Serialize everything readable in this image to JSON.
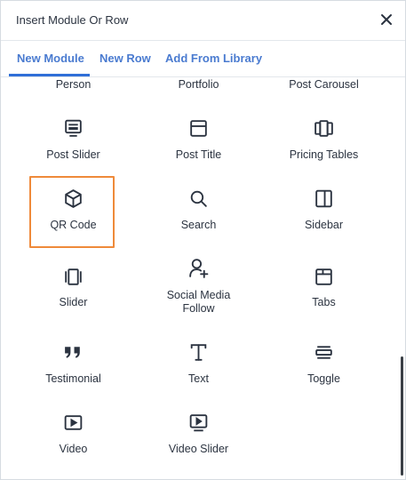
{
  "modal": {
    "title": "Insert Module Or Row",
    "close_icon": "close-icon"
  },
  "tabs": [
    {
      "label": "New Module",
      "active": true
    },
    {
      "label": "New Row",
      "active": false
    },
    {
      "label": "Add From Library",
      "active": false
    }
  ],
  "modules": {
    "row0": [
      "Person",
      "Portfolio",
      "Post Carousel"
    ],
    "row1": [
      "Post Slider",
      "Post Title",
      "Pricing Tables"
    ],
    "row2": [
      "QR Code",
      "Search",
      "Sidebar"
    ],
    "row3": [
      "Slider",
      "Social Media\nFollow",
      "Tabs"
    ],
    "row4": [
      "Testimonial",
      "Text",
      "Toggle"
    ],
    "row5": [
      "Video",
      "Video Slider"
    ]
  },
  "selected_module": "QR Code",
  "colors": {
    "accent": "#2f6fd8",
    "tab_text": "#4a7bd0",
    "selection": "#ef8a3a"
  }
}
